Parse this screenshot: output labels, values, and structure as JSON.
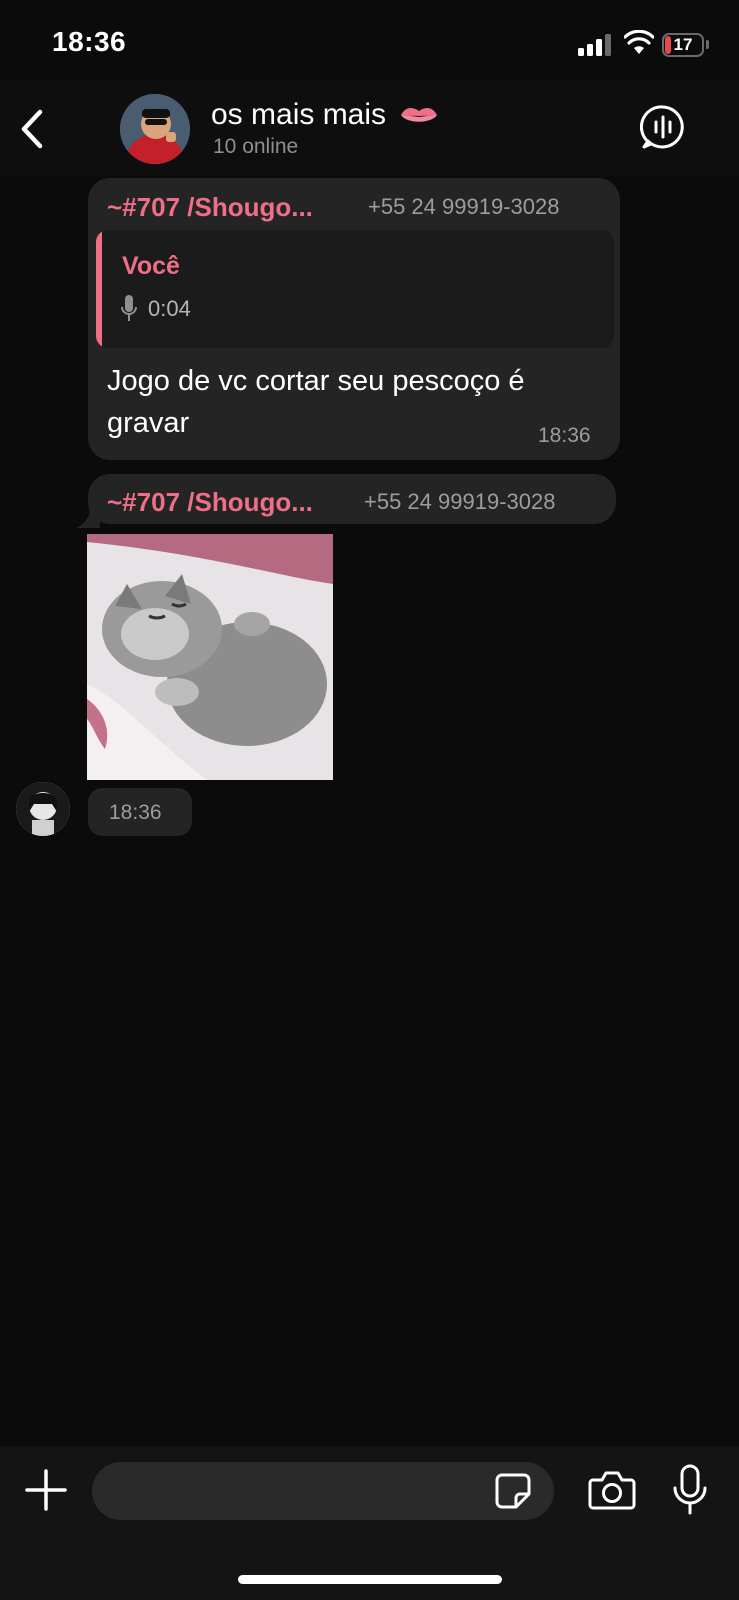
{
  "status_bar": {
    "time": "18:36",
    "battery": "17",
    "battery_level": 0.17,
    "battery_color": "#e5484d"
  },
  "header": {
    "title": "os mais mais",
    "subtitle": "10 online",
    "back_icon": "chevron-left-icon",
    "call_icon": "voice-chat-icon"
  },
  "messages": [
    {
      "sender": "~#707 /Shougo...",
      "phone": "+55 24 99919-3028",
      "reply": {
        "name": "Você",
        "duration": "0:04",
        "icon": "mic-icon"
      },
      "text": "Jogo de vc cortar seu pescoço é gravar",
      "time": "18:36"
    },
    {
      "sender": "~#707 /Shougo...",
      "phone": "+55 24 99919-3028",
      "sticker": "sleeping-cat-sticker",
      "time": "18:36"
    }
  ],
  "input": {
    "placeholder": ""
  },
  "colors": {
    "accent": "#ee6f87",
    "bubble": "#242424",
    "background": "#0b0b0b"
  }
}
